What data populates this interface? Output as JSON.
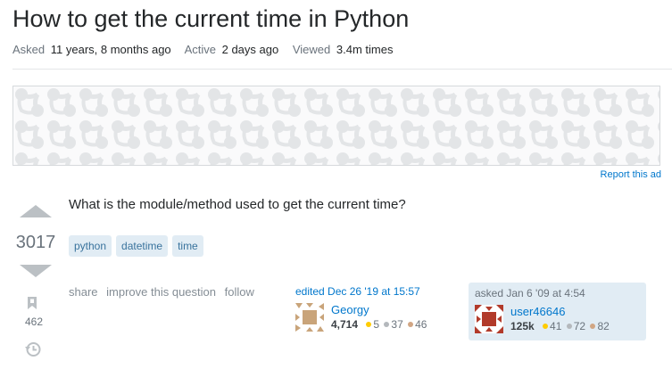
{
  "question": {
    "title": "How to get the current time in Python",
    "body": "What is the module/method used to get the current time?",
    "asked_label": "Asked",
    "asked_value": "11 years, 8 months ago",
    "active_label": "Active",
    "active_value": "2 days ago",
    "viewed_label": "Viewed",
    "viewed_value": "3.4m times",
    "score": "3017",
    "favorites": "462",
    "tags": [
      "python",
      "datetime",
      "time"
    ]
  },
  "ad": {
    "report_label": "Report this ad"
  },
  "post_menu": {
    "share": "share",
    "improve": "improve this question",
    "follow": "follow"
  },
  "editor": {
    "action": "edited Dec 26 '19 at 15:57",
    "name": "Georgy",
    "reputation": "4,714",
    "gold": "5",
    "silver": "37",
    "bronze": "46"
  },
  "asker": {
    "action": "asked Jan 6 '09 at 4:54",
    "name": "user46646",
    "reputation": "125k",
    "gold": "41",
    "silver": "72",
    "bronze": "82"
  },
  "colors": {
    "link": "#0077cc",
    "tag_bg": "#e1ecf4",
    "tag_text": "#39739d",
    "vote_arrow": "#bbc0c4",
    "gold": "#ffcc01",
    "silver": "#b4b8bc",
    "bronze": "#d1a684"
  }
}
